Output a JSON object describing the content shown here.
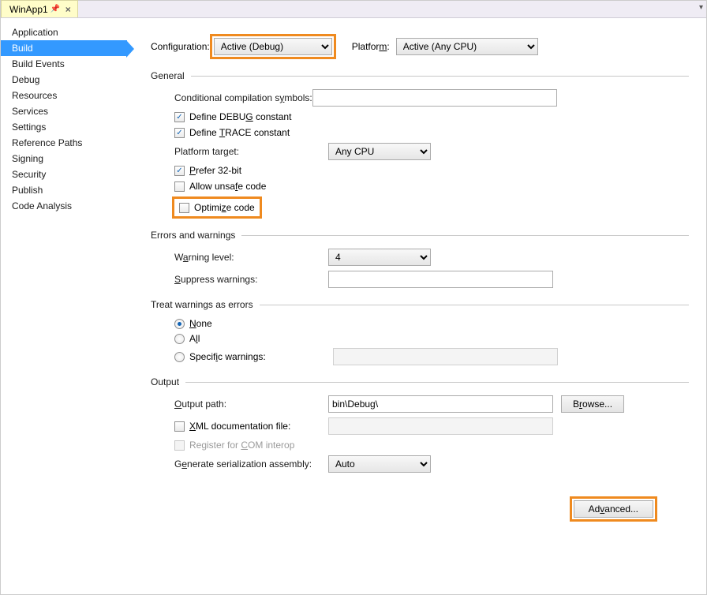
{
  "tab": {
    "title": "WinApp1"
  },
  "sidebar": {
    "items": [
      {
        "label": "Application"
      },
      {
        "label": "Build"
      },
      {
        "label": "Build Events"
      },
      {
        "label": "Debug"
      },
      {
        "label": "Resources"
      },
      {
        "label": "Services"
      },
      {
        "label": "Settings"
      },
      {
        "label": "Reference Paths"
      },
      {
        "label": "Signing"
      },
      {
        "label": "Security"
      },
      {
        "label": "Publish"
      },
      {
        "label": "Code Analysis"
      }
    ],
    "selectedIndex": 1
  },
  "header": {
    "configLabelPre": "Confi",
    "configLabelU": "g",
    "configLabelPost": "uration:",
    "configValue": "Active (Debug)",
    "platformLabelPre": "Platfor",
    "platformLabelU": "m",
    "platformLabelPost": ":",
    "platformValue": "Active (Any CPU)"
  },
  "general": {
    "title": "General",
    "condSymPre": "Conditional compilation s",
    "condSymU": "y",
    "condSymPost": "mbols:",
    "condSymValue": "",
    "defineDebugChecked": true,
    "defineDebugPre": "Define DEBU",
    "defineDebugU": "G",
    "defineDebugPost": " constant",
    "defineTraceChecked": true,
    "defineTracePre": "Define ",
    "defineTraceU": "T",
    "defineTracePost": "RACE constant",
    "platformTargetPre": "Platform tar",
    "platformTargetU": "g",
    "platformTargetPost": "et:",
    "platformTargetValue": "Any CPU",
    "prefer32Checked": true,
    "prefer32U": "P",
    "prefer32Post": "refer 32-bit",
    "allowUnsafeChecked": false,
    "allowUnsafePre": "Allow unsa",
    "allowUnsafeU": "f",
    "allowUnsafePost": "e code",
    "optimizeChecked": false,
    "optimizePre": "Optimi",
    "optimizeU": "z",
    "optimizePost": "e code"
  },
  "errors": {
    "title": "Errors and warnings",
    "warnLevelPre": "W",
    "warnLevelU": "a",
    "warnLevelPost": "rning level:",
    "warnLevelValue": "4",
    "suppressU": "S",
    "suppressPost": "uppress warnings:",
    "suppressValue": ""
  },
  "treat": {
    "title": "Treat warnings as errors",
    "noneU": "N",
    "nonePost": "one",
    "noneChecked": true,
    "allPre": "A",
    "allU": "l",
    "allPost": "l",
    "allChecked": false,
    "specificPre": "Specif",
    "specificU": "i",
    "specificPost": "c warnings:",
    "specificChecked": false,
    "specificValue": ""
  },
  "output": {
    "title": "Output",
    "outputPathU": "O",
    "outputPathPost": "utput path:",
    "outputPathValue": "bin\\Debug\\",
    "browsePre": "B",
    "browseU": "r",
    "browsePost": "owse...",
    "xmlDocChecked": false,
    "xmlDocU": "X",
    "xmlDocPost": "ML documentation file:",
    "xmlDocValue": "",
    "registerComChecked": false,
    "registerComPre": "Register for ",
    "registerComU": "C",
    "registerComPost": "OM interop",
    "genSerPre": "G",
    "genSerU": "e",
    "genSerPost": "nerate serialization assembly:",
    "genSerValue": "Auto",
    "advancedPre": "Ad",
    "advancedU": "v",
    "advancedPost": "anced..."
  }
}
